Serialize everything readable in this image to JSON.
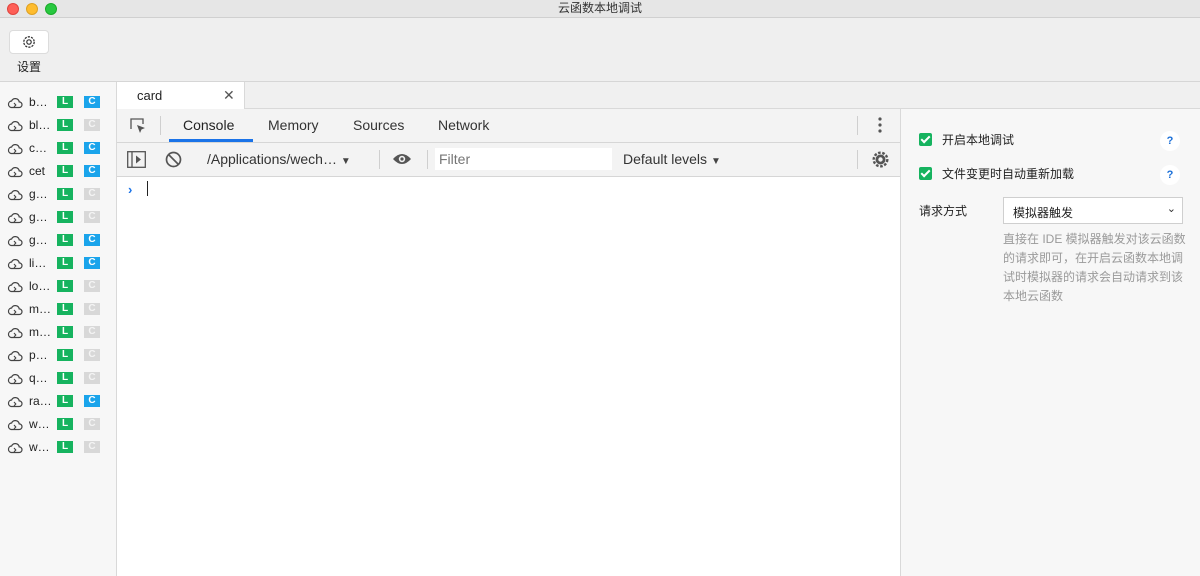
{
  "window": {
    "title": "云函数本地调试"
  },
  "toolbar": {
    "settings_label": "设置",
    "settings_icon": "gear-icon"
  },
  "doc_tab": {
    "label": "card",
    "close": "✕"
  },
  "functions": [
    {
      "name": "b…",
      "local": "L",
      "cloud": "C",
      "cloud_on": true
    },
    {
      "name": "bl…",
      "local": "L",
      "cloud": "C",
      "cloud_on": false
    },
    {
      "name": "c…",
      "local": "L",
      "cloud": "C",
      "cloud_on": true
    },
    {
      "name": "cet",
      "local": "L",
      "cloud": "C",
      "cloud_on": true
    },
    {
      "name": "g…",
      "local": "L",
      "cloud": "C",
      "cloud_on": false
    },
    {
      "name": "g…",
      "local": "L",
      "cloud": "C",
      "cloud_on": false
    },
    {
      "name": "g…",
      "local": "L",
      "cloud": "C",
      "cloud_on": true
    },
    {
      "name": "li…",
      "local": "L",
      "cloud": "C",
      "cloud_on": true
    },
    {
      "name": "lo…",
      "local": "L",
      "cloud": "C",
      "cloud_on": false
    },
    {
      "name": "m…",
      "local": "L",
      "cloud": "C",
      "cloud_on": false
    },
    {
      "name": "m…",
      "local": "L",
      "cloud": "C",
      "cloud_on": false
    },
    {
      "name": "p…",
      "local": "L",
      "cloud": "C",
      "cloud_on": false
    },
    {
      "name": "q…",
      "local": "L",
      "cloud": "C",
      "cloud_on": false
    },
    {
      "name": "ra…",
      "local": "L",
      "cloud": "C",
      "cloud_on": true
    },
    {
      "name": "w…",
      "local": "L",
      "cloud": "C",
      "cloud_on": false
    },
    {
      "name": "w…",
      "local": "L",
      "cloud": "C",
      "cloud_on": false
    }
  ],
  "devtools": {
    "tabs": [
      "Console",
      "Memory",
      "Sources",
      "Network"
    ],
    "active_tab": "Console",
    "context": "/Applications/wech…",
    "filter_placeholder": "Filter",
    "levels": "Default levels",
    "prompt": "›"
  },
  "options": {
    "enable_local_debug": {
      "label": "开启本地调试",
      "checked": true
    },
    "auto_reload": {
      "label": "文件变更时自动重新加载",
      "checked": true
    },
    "help": "?",
    "request_method_label": "请求方式",
    "request_method_value": "模拟器触发",
    "request_method_desc": "直接在 IDE 模拟器触发对该云函数的请求即可，在开启云函数本地调试时模拟器的请求会自动请求到该本地云函数"
  },
  "colors": {
    "accent_green": "#16b35f",
    "accent_blue": "#1aa4eb",
    "tab_underline": "#1a73e8"
  }
}
